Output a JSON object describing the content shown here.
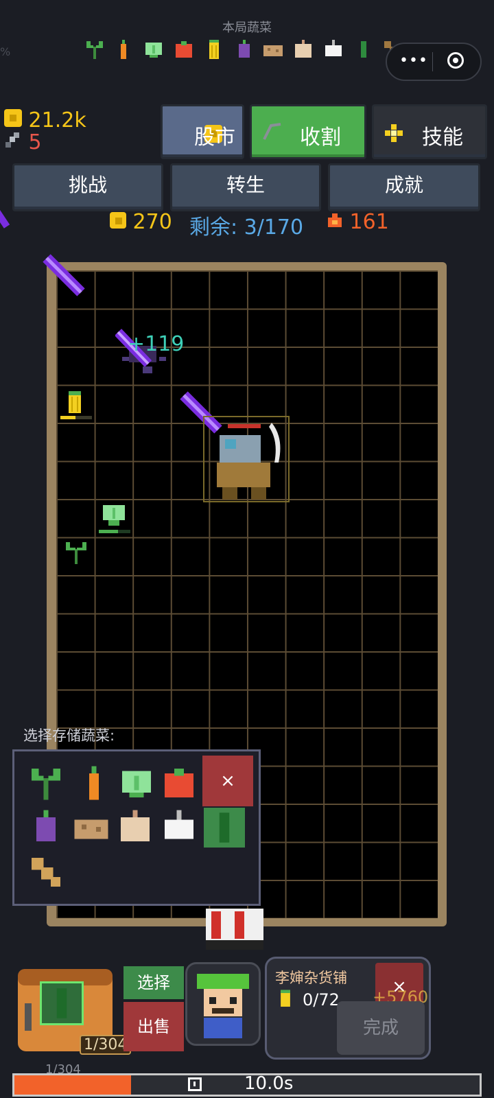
{
  "header": {
    "title": "本局蔬菜",
    "pct_fragment": "%",
    "veggies": [
      "sprout-icon",
      "carrot-icon",
      "cabbage-icon",
      "tomato-icon",
      "corn-icon",
      "eggplant-icon",
      "potato-icon",
      "onion-icon",
      "garlic-icon",
      "cucumber-icon",
      "bread-icon"
    ]
  },
  "stats": {
    "coins": "21.2k",
    "swords": "5"
  },
  "nav": {
    "stock_label": "股市",
    "harvest_label": "收割",
    "skills_label": "技能",
    "challenge_label": "挑战",
    "rebirth_label": "转生",
    "achievements_label": "成就"
  },
  "round": {
    "coins": "270",
    "remaining": "剩余: 3/170",
    "fire": "161"
  },
  "field": {
    "float_text": "+119"
  },
  "storage": {
    "title": "选择存储蔬菜:",
    "close_label": "×",
    "items": [
      "sprout-icon",
      "carrot-icon",
      "cabbage-icon",
      "tomato-icon",
      "eggplant-icon",
      "potato-icon",
      "onion-icon",
      "garlic-icon",
      "cucumber-icon",
      "bread-icon"
    ]
  },
  "bottom": {
    "chest_count": "1/304",
    "chest_count_below": "1/304",
    "select_label": "选择",
    "sell_label": "出售",
    "shop_name": "李婶杂货铺",
    "order_count": "0/72",
    "reward": "+5760",
    "close_label": "×",
    "done_label": "完成"
  },
  "timer": {
    "time": "10.0s",
    "progress": 0.25
  },
  "colors": {
    "accent_green": "#4cae4f",
    "accent_red": "#a0383a",
    "coin_yellow": "#f5c518",
    "sky_blue": "#5aa9e6",
    "fire_orange": "#f2622a"
  }
}
